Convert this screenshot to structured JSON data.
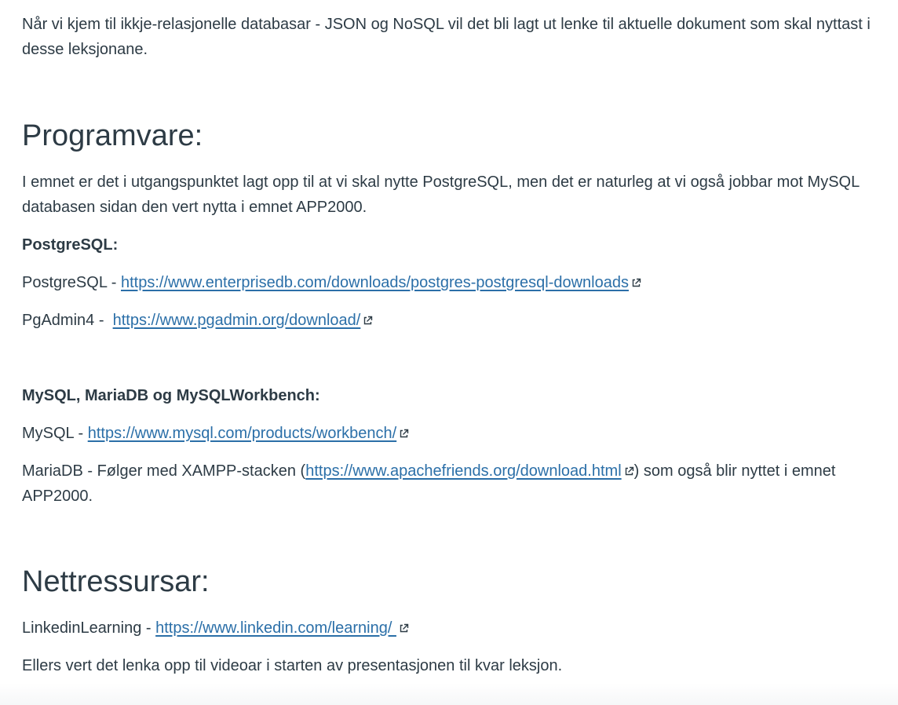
{
  "intro_text": "Når vi kjem til ikkje-relasjonelle databasar - JSON og NoSQL vil det bli lagt ut lenke til aktuelle dokument som skal nyttast i desse leksjonane.",
  "software": {
    "heading": "Programvare:",
    "description": "I emnet er det i utgangspunktet lagt opp til at vi skal nytte PostgreSQL, men det er naturleg at vi også jobbar mot MySQL databasen sidan den vert nytta i emnet APP2000.",
    "postgres_heading": "PostgreSQL:",
    "postgres_label": "PostgreSQL - ",
    "postgres_url": "https://www.enterprisedb.com/downloads/postgres-postgresql-downloads",
    "pgadmin_label": "PgAdmin4 -  ",
    "pgadmin_url": "https://www.pgadmin.org/download/",
    "mysql_heading": "MySQL, MariaDB og MySQLWorkbench:",
    "mysql_label": "MySQL - ",
    "mysql_url": "https://www.mysql.com/products/workbench/",
    "mariadb_prefix": "MariaDB - Følger med XAMPP-stacken (",
    "mariadb_url": "https://www.apachefriends.org/download.html",
    "mariadb_suffix": ") som også blir nyttet i emnet APP2000."
  },
  "web_resources": {
    "heading": "Nettressursar:",
    "linkedin_label": "LinkedinLearning - ",
    "linkedin_url": "https://www.linkedin.com/learning/ ",
    "closing_text": "Ellers vert det lenka opp til videoar i starten av presentasjonen til kvar leksjon."
  },
  "colors": {
    "text": "#2d3b45",
    "link": "#2b6fa8"
  },
  "icons": {
    "external_link": "external-link-icon"
  }
}
